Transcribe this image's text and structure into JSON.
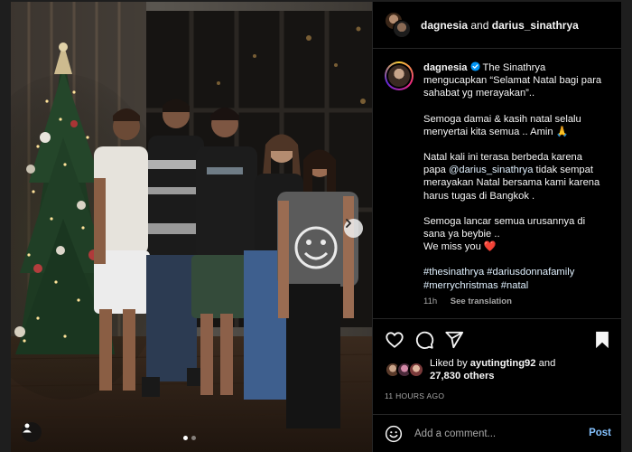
{
  "header": {
    "user1": "dagnesia",
    "and_text": "and",
    "user2": "darius_sinathrya"
  },
  "caption": {
    "username": "dagnesia",
    "para1": "The Sinathrya mengucapkan “Selamat Natal bagi para sahabat yg merayakan”..",
    "para2": "Semoga damai & kasih natal selalu menyertai kita semua .. Amin 🙏",
    "para3_a": "Natal kali ini terasa berbeda karena papa ",
    "para3_mention": "@darius_sinathrya",
    "para3_b": " tidak sempat merayakan Natal bersama kami karena harus tugas di Bangkok .",
    "para4": "Semoga lancar semua urusannya di sana ya beybie ..",
    "para5": "We miss you ❤️",
    "hashtags": "#thesinathrya #dariusdonnafamily #merrychristmas #natal",
    "time": "11h",
    "see_translation": "See translation"
  },
  "likes": {
    "prefix": "Liked by",
    "user": "ayutingting92",
    "and_text": "and",
    "others": "27,830 others"
  },
  "timeago": "11 HOURS AGO",
  "comment": {
    "placeholder": "Add a comment...",
    "post_label": "Post"
  },
  "carousel": {
    "slides": 2,
    "active": 1
  },
  "colors": {
    "accent": "#85c2ff",
    "verified": "#0095f6",
    "heart": "#ff3040"
  },
  "icons": [
    "next-arrow-icon",
    "user-tag-icon",
    "heart-icon",
    "comment-icon",
    "share-icon",
    "bookmark-icon",
    "emoji-icon",
    "verified-icon"
  ]
}
